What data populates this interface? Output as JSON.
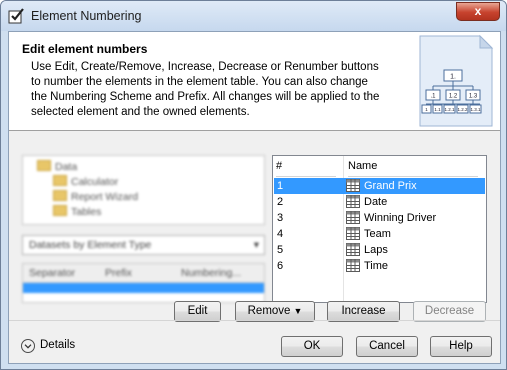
{
  "window": {
    "title": "Element Numbering",
    "close_glyph": "x"
  },
  "header": {
    "title": "Edit element numbers",
    "description": "Use Edit, Create/Remove, Increase, Decrease or Renumber buttons to number the elements in the element table. You can also change the Numbering Scheme and Prefix. All changes will be applied to the selected element and the owned elements.",
    "graphic": {
      "labels": [
        "1.",
        ".1",
        "1.2",
        "1.3",
        "1",
        "1.1",
        "1.2.1",
        "1.2.2",
        "1.3.1"
      ]
    }
  },
  "left_panel": {
    "tree_items": [
      "Data",
      "Calculator",
      "Report Wizard",
      "Tables"
    ],
    "dataset_combo": "Datasets by Element Type",
    "separator_table": {
      "columns": [
        "Separator",
        "Prefix",
        "Numbering..."
      ]
    }
  },
  "element_table": {
    "columns": [
      "#",
      "Name"
    ],
    "rows": [
      {
        "num": "1",
        "name": "Grand Prix",
        "selected": true
      },
      {
        "num": "2",
        "name": "Date",
        "selected": false
      },
      {
        "num": "3",
        "name": "Winning Driver",
        "selected": false
      },
      {
        "num": "4",
        "name": "Team",
        "selected": false
      },
      {
        "num": "5",
        "name": "Laps",
        "selected": false
      },
      {
        "num": "6",
        "name": "Time",
        "selected": false
      }
    ],
    "row_icon": "table-icon"
  },
  "buttons": {
    "edit": "Edit",
    "remove": "Remove",
    "increase": "Increase",
    "decrease": "Decrease",
    "ok": "OK",
    "cancel": "Cancel",
    "help": "Help"
  },
  "details": {
    "label": "Details",
    "icon": "chevron-down-icon"
  },
  "colors": {
    "selection": "#3399ff",
    "title_gradient": "#c6d8ee",
    "close": "#c7432e"
  }
}
